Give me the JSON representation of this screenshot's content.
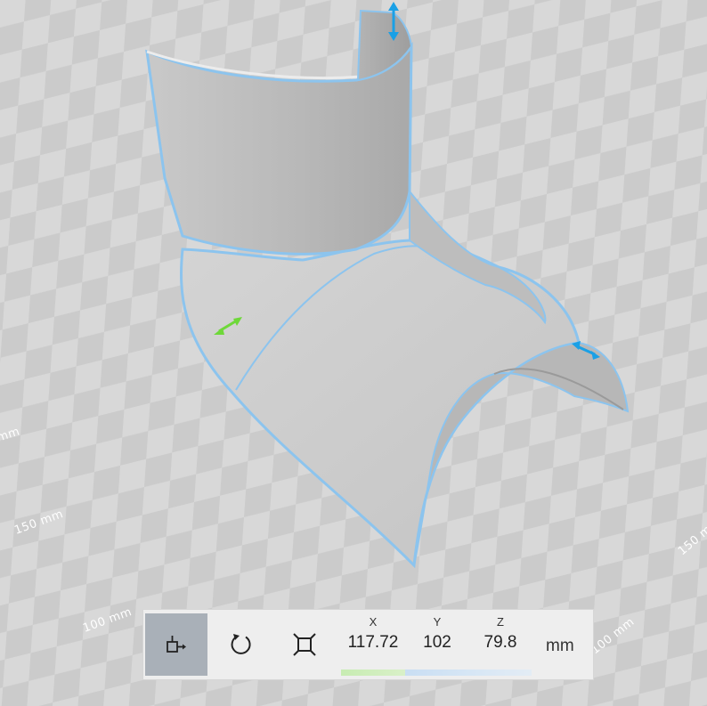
{
  "viewport": {
    "scale_labels": [
      "mm",
      "150 mm",
      "100 mm",
      "150 m",
      "100 mm"
    ]
  },
  "toolbar": {
    "tools": [
      {
        "name": "move",
        "icon": "move-tool-icon",
        "active": true
      },
      {
        "name": "rotate",
        "icon": "rotate-icon",
        "active": false
      },
      {
        "name": "scale",
        "icon": "scale-icon",
        "active": false
      }
    ],
    "axes": {
      "x_label": "X",
      "x_value": "117.72",
      "y_label": "Y",
      "y_value": "102",
      "z_label": "Z",
      "z_value": "79.8"
    },
    "unit": "mm"
  },
  "colors": {
    "selection_outline": "#8cc4ee",
    "handle_blue": "#1aa0e6",
    "handle_green": "#6ed839",
    "active_tool": "#a9b0b8"
  }
}
